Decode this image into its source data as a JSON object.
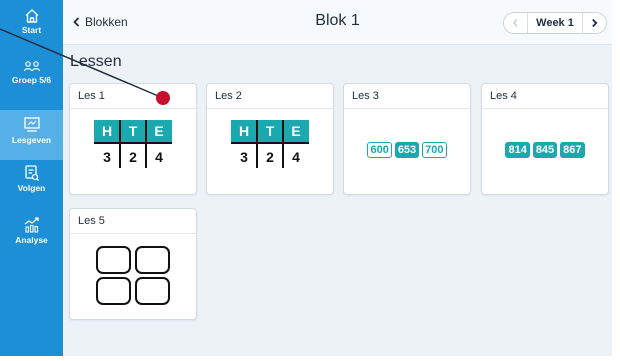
{
  "nav": {
    "items": [
      {
        "label": "Start",
        "icon": "home-icon"
      },
      {
        "label": "Groep 5/6",
        "icon": "group-icon"
      },
      {
        "label": "Lesgeven",
        "icon": "teach-icon"
      },
      {
        "label": "Volgen",
        "icon": "track-icon"
      },
      {
        "label": "Analyse",
        "icon": "analysis-icon"
      }
    ],
    "active": "Lesgeven"
  },
  "header": {
    "back_label": "Blokken",
    "title": "Blok 1",
    "week_label": "Week 1"
  },
  "section_title": "Lessen",
  "lessons": [
    {
      "title": "Les 1",
      "thumb": "hte-table",
      "hte": {
        "headers": [
          "H",
          "T",
          "E"
        ],
        "digits": [
          "3",
          "2",
          "4"
        ]
      }
    },
    {
      "title": "Les 2",
      "thumb": "hte-table",
      "hte": {
        "headers": [
          "H",
          "T",
          "E"
        ],
        "digits": [
          "3",
          "2",
          "4"
        ]
      }
    },
    {
      "title": "Les 3",
      "thumb": "number-tiles",
      "numbers": [
        "600",
        "653",
        "700"
      ]
    },
    {
      "title": "Les 4",
      "thumb": "number-tiles",
      "numbers": [
        "814",
        "845",
        "867"
      ]
    },
    {
      "title": "Les 5",
      "thumb": "four-squares"
    }
  ],
  "colors": {
    "sidebar": "#1d8fd6",
    "sidebar_active": "#55b0e8",
    "teal": "#1ba9b0",
    "pointer": "#c8102e",
    "background": "#edf2f7"
  }
}
